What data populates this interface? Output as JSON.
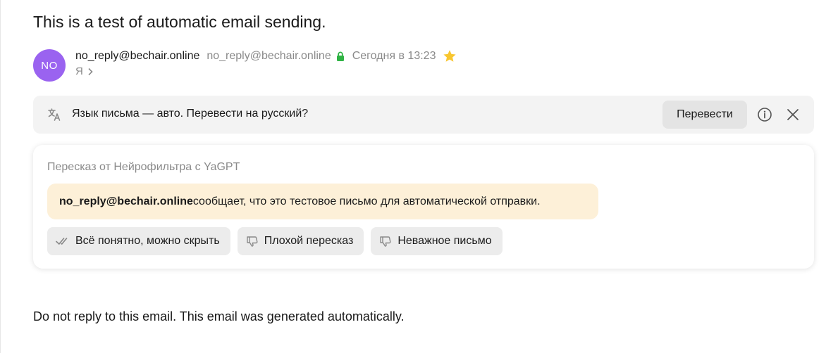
{
  "email": {
    "subject": "This is a test of automatic email sending.",
    "avatar_initials": "NO",
    "avatar_color": "#9a63f0",
    "sender_name": "no_reply@bechair.online",
    "sender_email": "no_reply@bechair.online",
    "date": "Сегодня в 13:23",
    "recipient": "Я",
    "body": "Do not reply to this email. This email was generated automatically."
  },
  "translate_bar": {
    "text": "Язык письма — авто. Перевести на русский?",
    "translate_button": "Перевести",
    "icons": [
      "translate-icon",
      "info-icon",
      "close-icon"
    ]
  },
  "summary": {
    "title": "Пересказ от Нейрофильтра с YaGPT",
    "sender_bold": "no_reply@bechair.online",
    "text": " сообщает, что это тестовое письмо для автоматической отправки.",
    "bubble_color": "#fdf0d8",
    "actions": [
      {
        "label": "Всё понятно, можно скрыть",
        "icon": "double-check-icon"
      },
      {
        "label": "Плохой пересказ",
        "icon": "thumbs-down-icon"
      },
      {
        "label": "Неважное письмо",
        "icon": "thumbs-down-icon"
      }
    ]
  },
  "colors": {
    "lock_green": "#2fb344",
    "star_yellow": "#f8c630"
  }
}
